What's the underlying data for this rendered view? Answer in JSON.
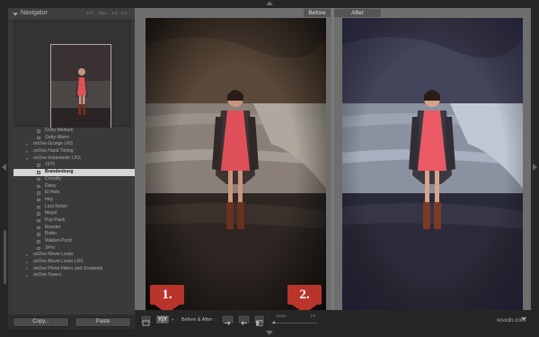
{
  "navigator": {
    "title": "Navigator",
    "zoom_options": [
      "FIT",
      "FILL",
      "1:1",
      "3:1"
    ]
  },
  "presets": [
    {
      "label": "Gritty-Medium",
      "level": 2,
      "type": "item",
      "selected": false
    },
    {
      "label": "Gritty-Warm",
      "level": 2,
      "type": "item",
      "selected": false
    },
    {
      "label": "onOne Grunge LRS",
      "level": 1,
      "type": "folder-closed",
      "selected": false
    },
    {
      "label": "onOne Hand Tinting",
      "level": 1,
      "type": "folder-closed",
      "selected": false
    },
    {
      "label": "onOne Instantastic LRS",
      "level": 1,
      "type": "folder-open",
      "selected": false
    },
    {
      "label": "1975",
      "level": 2,
      "type": "item",
      "selected": false
    },
    {
      "label": "Brandenburg",
      "level": 2,
      "type": "item",
      "selected": true
    },
    {
      "label": "Crossify",
      "level": 2,
      "type": "item",
      "selected": false
    },
    {
      "label": "Daisy",
      "level": 2,
      "type": "item",
      "selected": false
    },
    {
      "label": "El Hefe",
      "level": 2,
      "type": "item",
      "selected": false
    },
    {
      "label": "Inky",
      "level": 2,
      "type": "item",
      "selected": false
    },
    {
      "label": "Lord Kelvin",
      "level": 2,
      "type": "item",
      "selected": false
    },
    {
      "label": "Mayor",
      "level": 2,
      "type": "item",
      "selected": false
    },
    {
      "label": "Pop Flash",
      "level": 2,
      "type": "item",
      "selected": false
    },
    {
      "label": "Roaster",
      "level": 2,
      "type": "item",
      "selected": false
    },
    {
      "label": "Robin",
      "level": 2,
      "type": "item",
      "selected": false
    },
    {
      "label": "Walden Pond",
      "level": 2,
      "type": "item",
      "selected": false
    },
    {
      "label": "XPro",
      "level": 2,
      "type": "item",
      "selected": false
    },
    {
      "label": "onOne Movie Looks",
      "level": 1,
      "type": "folder-closed",
      "selected": false
    },
    {
      "label": "onOne Movie Looks LRS",
      "level": 1,
      "type": "folder-closed",
      "selected": false
    },
    {
      "label": "onOne Photo Filters and Gradients",
      "level": 1,
      "type": "folder-closed",
      "selected": false
    },
    {
      "label": "onOne Toners",
      "level": 1,
      "type": "folder-closed",
      "selected": false
    }
  ],
  "left_buttons": {
    "copy": "Copy...",
    "paste": "Paste"
  },
  "views": {
    "before": "Before",
    "after": "After"
  },
  "toolbar": {
    "yy_label": "Y|Y",
    "before_after_label": "Before & After :",
    "zoom_label": "Zoom",
    "fit_label": "Fit"
  },
  "callouts": {
    "one": "1.",
    "two": "2."
  },
  "watermark": "wsxdn.com",
  "colors": {
    "callout": "#b9342b",
    "dress": "#e0505a",
    "selection": "#d6d6d6"
  }
}
